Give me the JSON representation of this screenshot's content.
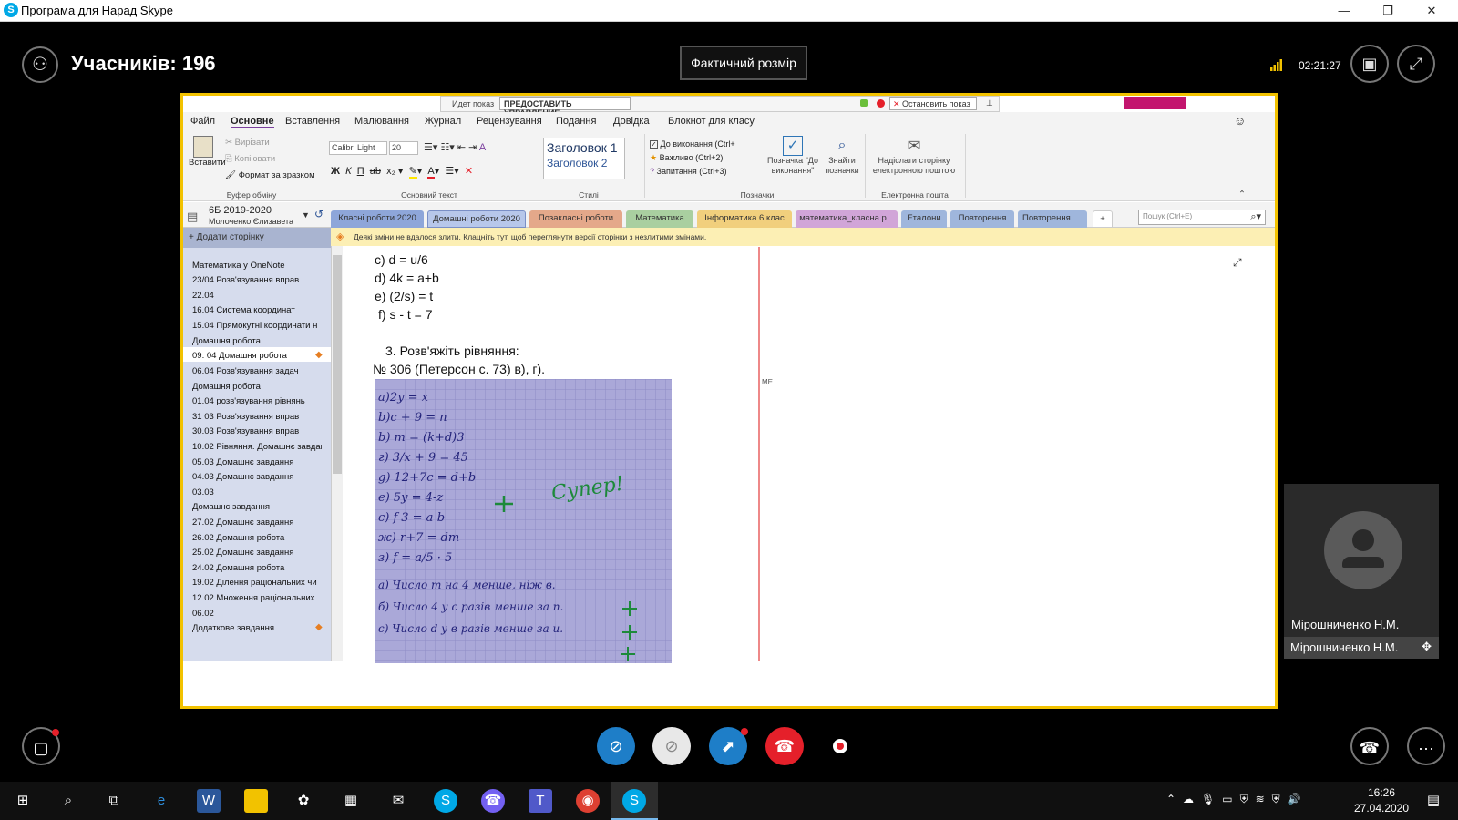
{
  "window": {
    "title": "Програма для Нарад Skype",
    "minimize": "—",
    "restore": "❐",
    "close": "✕"
  },
  "meeting": {
    "participants_label": "Учасників: 196",
    "actual_size_button": "Фактичний розмір",
    "elapsed_time": "02:21:27"
  },
  "share_toolbar": {
    "status": "Идет показ",
    "give_control": "ПРЕДОСТАВИТЬ УПРАВЛЕНИЕ",
    "stop_sharing": "Остановить показ"
  },
  "onenote": {
    "menu": [
      "Файл",
      "Основне",
      "Вставлення",
      "Малювання",
      "Журнал",
      "Рецензування",
      "Подання",
      "Довідка",
      "Блокнот для класу"
    ],
    "clipboard": {
      "paste": "Вставити",
      "cut": "Вирізати",
      "copy": "Копіювати",
      "format_painter": "Формат за зразком",
      "group": "Буфер обміну"
    },
    "basic_text": {
      "font": "Calibri Light",
      "size": "20",
      "group": "Основний текст"
    },
    "styles": {
      "heading1": "Заголовок 1",
      "heading2": "Заголовок 2",
      "group": "Стилі"
    },
    "tags": {
      "todo": "До виконання (Ctrl+",
      "important": "Важливо (Ctrl+2)",
      "question": "Запитання (Ctrl+3)",
      "todo_tag_1": "Позначка \"До",
      "todo_tag_2": "виконання\"",
      "find_tags_1": "Знайти",
      "find_tags_2": "позначки",
      "group": "Позначки"
    },
    "email": {
      "line1": "Надіслати сторінку",
      "line2": "електронною поштою",
      "group": "Електронна пошта"
    },
    "notebook": {
      "name": "6Б 2019-2020",
      "owner": "Молоченко Єлизавета"
    },
    "sections": [
      {
        "label": "Класні роботи 2020",
        "color": "#8ea6d9"
      },
      {
        "label": "Домашні роботи 2020",
        "color": "#8ea6d9"
      },
      {
        "label": "Позакласні роботи",
        "color": "#e4a88a"
      },
      {
        "label": "Математика",
        "color": "#a9cfa0"
      },
      {
        "label": "Інформатика 6 клас",
        "color": "#f1cf7d"
      },
      {
        "label": "математика_класна р...",
        "color": "#d1a5d8"
      },
      {
        "label": "Еталони",
        "color": "#9fb6dc"
      },
      {
        "label": "Повторення",
        "color": "#9fb6dc"
      },
      {
        "label": "Повторення. ...",
        "color": "#9fb6dc"
      }
    ],
    "search_placeholder": "Пошук (Ctrl+E)",
    "add_page": "Додати сторінку",
    "pages": [
      "Математика у OneNote",
      "23/04  Розв'язування вправ",
      "22.04",
      "16.04 Система координат",
      "15.04 Прямокутні координати н",
      "Домашня робота",
      "09. 04 Домашня робота",
      "06.04 Розв'язування задач",
      "Домашня робота",
      "01.04 розв'язування рівнянь",
      "31 03  Розв'язування вправ",
      "30.03 Розв'язування вправ",
      "10.02 Рівняння. Домашнє завдан",
      "05.03 Домашнє завдання",
      "04.03 Домашнє завдання",
      "03.03",
      "Домашнє завдання",
      "27.02 Домашнє завдання",
      "26.02 Домашня робота",
      "25.02 Домашнє завдання",
      "24.02 Домашня робота",
      "19.02  Ділення раціональних чи",
      "12.02 Множення раціональних",
      "06.02",
      "Додаткове завдання"
    ],
    "notice": "Деякі зміни не вдалося злити. Клацніть тут, щоб переглянути версії сторінки з незлитими змінами.",
    "content": {
      "equations": [
        "c)  d = u/6",
        "d)  4k = a+b",
        "e)  (2/s) = t",
        "f)  s - t = 7"
      ],
      "task_heading": "3. Розв'яжіть рівняння:",
      "task_ref": "№ 306 (Петерсон с.  73) в), г).",
      "author_tag": "ME",
      "handwriting": [
        "a)2y = x",
        "b)c + 9 = n",
        "b) m = (k+d)3",
        "г) 3/x + 9 = 45",
        "g) 12+7c = d+b",
        "e) 5y = 4-z",
        "є) f-3 = a-b",
        "ж) r+7 = dm",
        "з) f = a/5 · 5",
        "а) Число т на 4 менше, ніж в.",
        "б) Число 4 у c разів менше за п.",
        "с) Число d у в разів менше за и."
      ],
      "grade_text": "Супер!"
    }
  },
  "video": {
    "participant_name": "Мірошниченко Н.М.",
    "participant_bar": "Мірошниченко Н.М."
  },
  "taskbar": {
    "time": "16:26",
    "date": "27.04.2020"
  },
  "colors": {
    "share_border": "#f2c200",
    "hangup": "#e5202a",
    "skype_blue": "#1e7ec8"
  }
}
